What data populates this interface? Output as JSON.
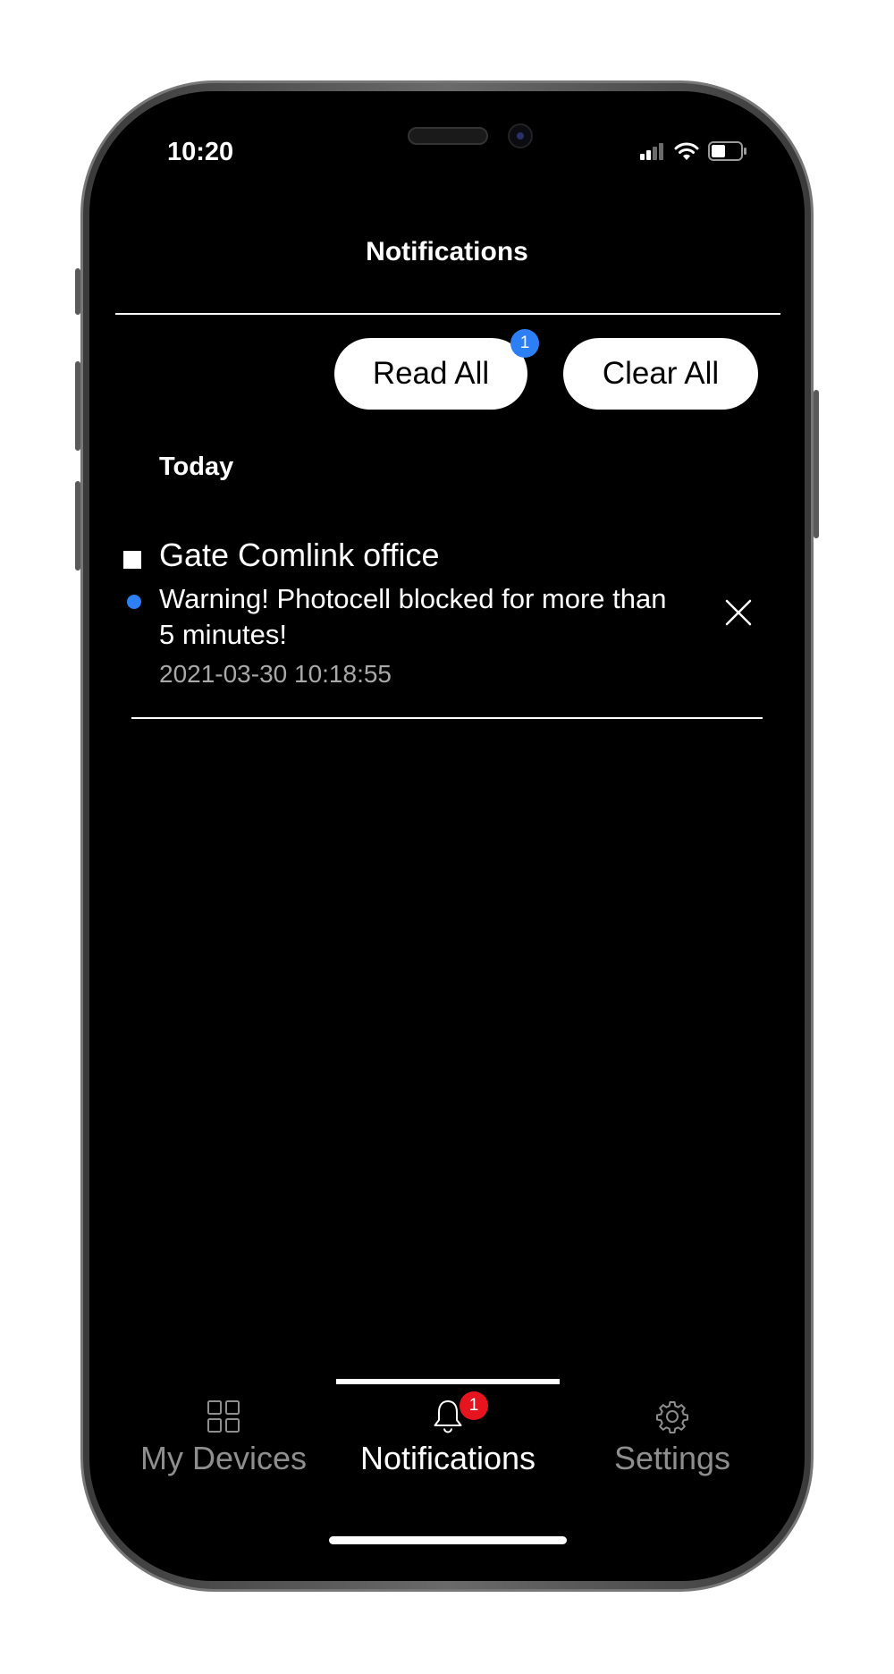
{
  "status_bar": {
    "time": "10:20",
    "icons": [
      "cellular-signal-icon",
      "wifi-icon",
      "battery-icon"
    ]
  },
  "header": {
    "title": "Notifications"
  },
  "actions": {
    "read_all_label": "Read All",
    "read_all_badge": "1",
    "clear_all_label": "Clear All"
  },
  "sections": [
    {
      "heading": "Today",
      "items": [
        {
          "device": "Gate Comlink office",
          "message": "Warning! Photocell blocked for more than 5 minutes!",
          "timestamp": "2021-03-30 10:18:55",
          "unread": true,
          "icon": "close-icon"
        }
      ]
    }
  ],
  "tab_bar": {
    "tabs": [
      {
        "label": "My Devices",
        "icon": "grid-icon",
        "active": false
      },
      {
        "label": "Notifications",
        "icon": "bell-icon",
        "active": true,
        "badge": "1"
      },
      {
        "label": "Settings",
        "icon": "gear-icon",
        "active": false
      }
    ]
  },
  "colors": {
    "background": "#000000",
    "accent_blue": "#2d7ff5",
    "badge_red": "#e6141e",
    "inactive_tab": "#8e8e8e",
    "timestamp_gray": "#a8a8a8"
  }
}
